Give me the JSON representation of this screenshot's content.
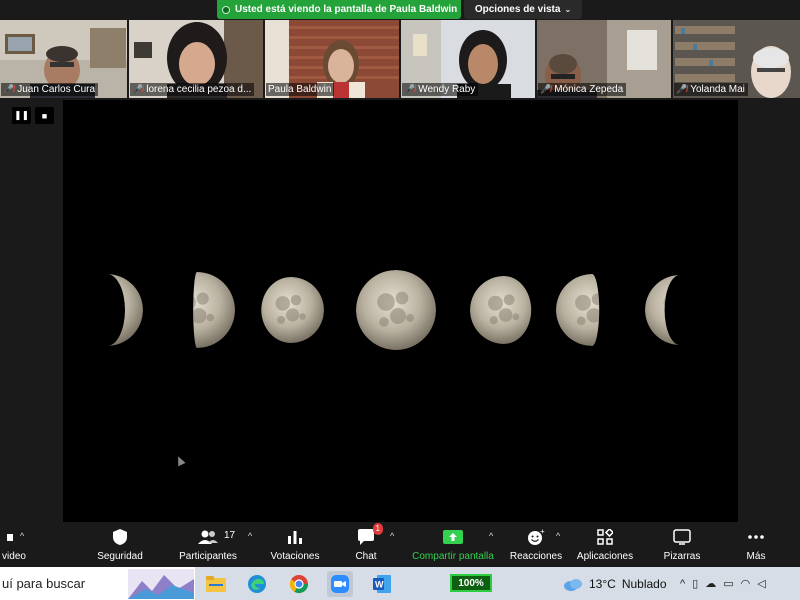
{
  "banner": {
    "share_text": "Usted está viendo la pantalla de Paula Baldwin",
    "view_options": "Opciones de vista"
  },
  "participants": [
    {
      "name": "Juan Carlos Cura",
      "muted": true
    },
    {
      "name": "lorena cecilia pezoa d...",
      "muted": true
    },
    {
      "name": "Paula Baldwin",
      "muted": false,
      "active_speaker": true
    },
    {
      "name": "Wendy Raby",
      "muted": true
    },
    {
      "name": "Mónica Zepeda",
      "muted": true
    },
    {
      "name": "Yolanda Mai",
      "muted": true
    }
  ],
  "share_controls": {
    "pause_icon": "pause-icon",
    "stop_icon": "stop-icon"
  },
  "shared_content": {
    "description_icon": "moon-phases-image",
    "moon_phases": [
      {
        "phase": "waxing-crescent"
      },
      {
        "phase": "first-quarter"
      },
      {
        "phase": "waxing-gibbous"
      },
      {
        "phase": "full"
      },
      {
        "phase": "waning-gibbous"
      },
      {
        "phase": "last-quarter"
      },
      {
        "phase": "waning-crescent"
      }
    ]
  },
  "toolbar": {
    "video_label": "video",
    "security_label": "Seguridad",
    "participants_label": "Participantes",
    "participants_count": "17",
    "polls_label": "Votaciones",
    "chat_label": "Chat",
    "chat_badge": "1",
    "share_label": "Compartir pantalla",
    "reactions_label": "Reacciones",
    "apps_label": "Aplicaciones",
    "whiteboards_label": "Pizarras",
    "more_label": "Más"
  },
  "taskbar": {
    "search_text": "uí para buscar",
    "battery_app_label": "100%",
    "weather_temp": "13°C",
    "weather_condition": "Nublado"
  },
  "colors": {
    "share_green": "#23a33a",
    "active_speaker_border": "#7ad46b",
    "muted_red": "#e74c3c",
    "toolbar_bg": "#1a1a1a",
    "taskbar_bg": "#d7dde6"
  }
}
